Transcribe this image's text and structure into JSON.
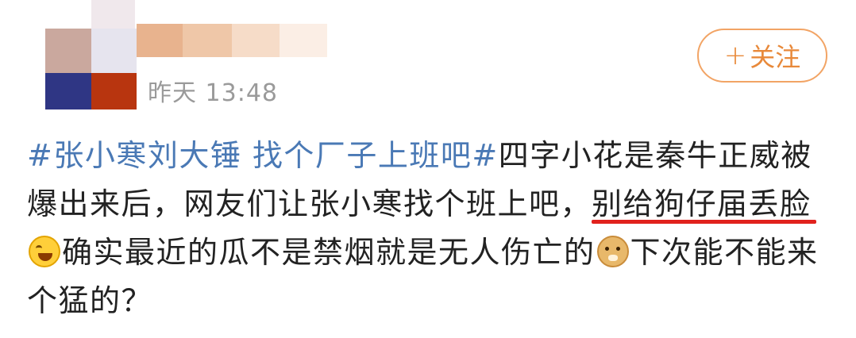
{
  "post": {
    "time": "昨天 13:48",
    "follow_label": "关注",
    "follow_plus": "+",
    "content": {
      "topic": "#张小寒刘大锤 找个厂子上班吧#",
      "part1": "四字小花是秦牛正威被爆出来后，网友们让张小寒找个班上吧，",
      "underlined": "别给狗仔届丢脸",
      "part2": "确实最近的瓜不是禁烟就是无人伤亡的",
      "part3": "下次能不能来个猛的？"
    }
  },
  "icons": {
    "laugh": "laughing-crying-emoji-icon",
    "doge": "doge-emoji-icon"
  },
  "colors": {
    "topic": "#4a79b5",
    "follow": "#e8893a",
    "underline": "#e1221d",
    "time": "#9a9a9a"
  }
}
